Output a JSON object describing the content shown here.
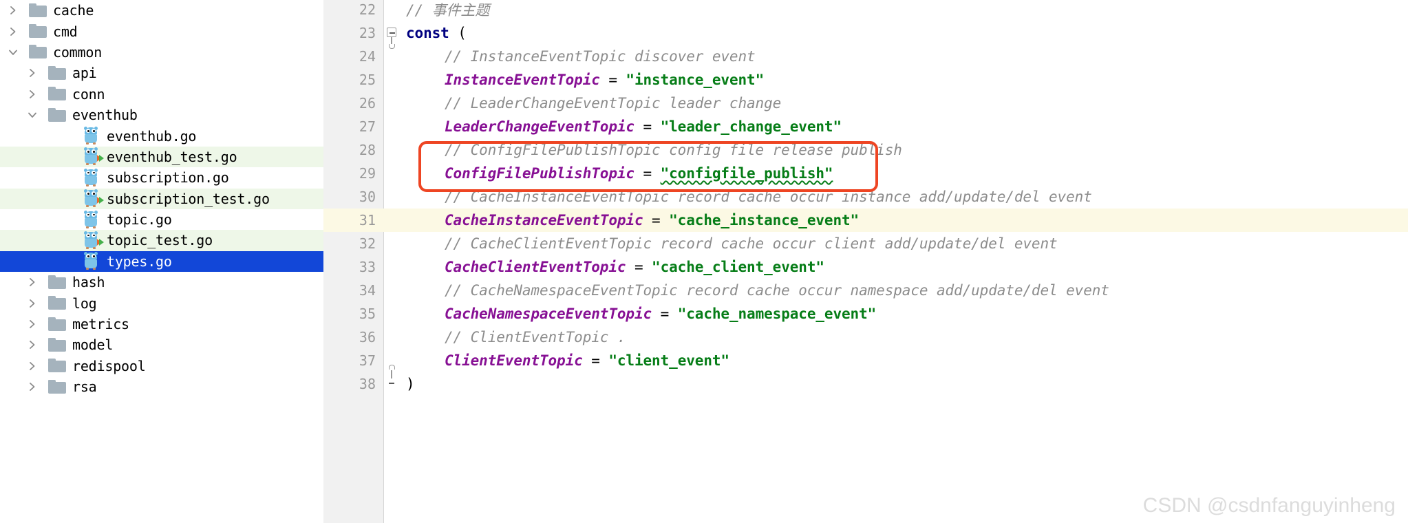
{
  "colors": {
    "selection_blue": "#1247d8",
    "modified_green": "#eef7e8",
    "caret_line_yellow": "#fcf9e4",
    "annotation_red": "#ee4523",
    "keyword_navy": "#000080",
    "identifier_purple": "#871094",
    "string_green": "#067d17",
    "comment_gray": "#8c8c8c",
    "gutter_gray": "#f1f1f1",
    "folder_gray": "#a5b3bd",
    "gopher_blue": "#69b9e4"
  },
  "sidebar": {
    "name": "project-file-tree",
    "items": [
      {
        "label": "cache",
        "type": "folder",
        "depth": 0,
        "expanded": false,
        "state": "normal",
        "icon": "folder-icon"
      },
      {
        "label": "cmd",
        "type": "folder",
        "depth": 0,
        "expanded": false,
        "state": "normal",
        "icon": "folder-icon"
      },
      {
        "label": "common",
        "type": "folder",
        "depth": 0,
        "expanded": true,
        "state": "normal",
        "icon": "folder-open-icon"
      },
      {
        "label": "api",
        "type": "folder",
        "depth": 1,
        "expanded": false,
        "state": "normal",
        "icon": "folder-icon"
      },
      {
        "label": "conn",
        "type": "folder",
        "depth": 1,
        "expanded": false,
        "state": "normal",
        "icon": "folder-icon"
      },
      {
        "label": "eventhub",
        "type": "folder",
        "depth": 1,
        "expanded": true,
        "state": "normal",
        "icon": "folder-open-icon"
      },
      {
        "label": "eventhub.go",
        "type": "gofile",
        "depth": 2,
        "expanded": null,
        "state": "normal",
        "icon": "go-file-icon"
      },
      {
        "label": "eventhub_test.go",
        "type": "gotest",
        "depth": 2,
        "expanded": null,
        "state": "modified",
        "icon": "go-test-file-icon"
      },
      {
        "label": "subscription.go",
        "type": "gofile",
        "depth": 2,
        "expanded": null,
        "state": "normal",
        "icon": "go-file-icon"
      },
      {
        "label": "subscription_test.go",
        "type": "gotest",
        "depth": 2,
        "expanded": null,
        "state": "modified",
        "icon": "go-test-file-icon"
      },
      {
        "label": "topic.go",
        "type": "gofile",
        "depth": 2,
        "expanded": null,
        "state": "normal",
        "icon": "go-file-icon"
      },
      {
        "label": "topic_test.go",
        "type": "gotest",
        "depth": 2,
        "expanded": null,
        "state": "modified",
        "icon": "go-test-file-icon"
      },
      {
        "label": "types.go",
        "type": "gofile",
        "depth": 2,
        "expanded": null,
        "state": "selected",
        "icon": "go-file-icon"
      },
      {
        "label": "hash",
        "type": "folder",
        "depth": 1,
        "expanded": false,
        "state": "normal",
        "icon": "folder-icon"
      },
      {
        "label": "log",
        "type": "folder",
        "depth": 1,
        "expanded": false,
        "state": "normal",
        "icon": "folder-icon"
      },
      {
        "label": "metrics",
        "type": "folder",
        "depth": 1,
        "expanded": false,
        "state": "normal",
        "icon": "folder-icon"
      },
      {
        "label": "model",
        "type": "folder",
        "depth": 1,
        "expanded": false,
        "state": "normal",
        "icon": "folder-icon"
      },
      {
        "label": "redispool",
        "type": "folder",
        "depth": 1,
        "expanded": false,
        "state": "normal",
        "icon": "folder-icon"
      },
      {
        "label": "rsa",
        "type": "folder",
        "depth": 1,
        "expanded": false,
        "state": "normal",
        "icon": "folder-icon"
      }
    ]
  },
  "editor": {
    "name": "code-editor",
    "language": "go",
    "first_line": 22,
    "caret_line": 31,
    "lines": [
      {
        "number": 22,
        "indent": 0,
        "fold": null,
        "tokens": [
          {
            "t": "comment",
            "v": "// 事件主题"
          }
        ]
      },
      {
        "number": 23,
        "indent": 0,
        "fold": "start",
        "tokens": [
          {
            "t": "kw",
            "v": "const"
          },
          {
            "t": "plain",
            "v": " "
          },
          {
            "t": "op",
            "v": "("
          }
        ]
      },
      {
        "number": 24,
        "indent": 1,
        "fold": null,
        "tokens": [
          {
            "t": "comment",
            "v": "// InstanceEventTopic discover event"
          }
        ]
      },
      {
        "number": 25,
        "indent": 1,
        "fold": null,
        "tokens": [
          {
            "t": "ident",
            "v": "InstanceEventTopic"
          },
          {
            "t": "plain",
            "v": " "
          },
          {
            "t": "op",
            "v": "="
          },
          {
            "t": "plain",
            "v": " "
          },
          {
            "t": "str",
            "v": "\"instance_event\""
          }
        ]
      },
      {
        "number": 26,
        "indent": 1,
        "fold": null,
        "tokens": [
          {
            "t": "comment",
            "v": "// LeaderChangeEventTopic leader change"
          }
        ]
      },
      {
        "number": 27,
        "indent": 1,
        "fold": null,
        "tokens": [
          {
            "t": "ident",
            "v": "LeaderChangeEventTopic"
          },
          {
            "t": "plain",
            "v": " "
          },
          {
            "t": "op",
            "v": "="
          },
          {
            "t": "plain",
            "v": " "
          },
          {
            "t": "str",
            "v": "\"leader_change_event\""
          }
        ]
      },
      {
        "number": 28,
        "indent": 1,
        "fold": null,
        "tokens": [
          {
            "t": "comment",
            "v": "// ConfigFilePublishTopic config file release publish"
          }
        ]
      },
      {
        "number": 29,
        "indent": 1,
        "fold": null,
        "tokens": [
          {
            "t": "ident",
            "v": "ConfigFilePublishTopic"
          },
          {
            "t": "plain",
            "v": " "
          },
          {
            "t": "op",
            "v": "="
          },
          {
            "t": "plain",
            "v": " "
          },
          {
            "t": "str-squiggle",
            "v": "\"configfile_publish\""
          }
        ]
      },
      {
        "number": 30,
        "indent": 1,
        "fold": null,
        "tokens": [
          {
            "t": "comment",
            "v": "// CacheInstanceEventTopic record cache occur instance add/update/del event"
          }
        ]
      },
      {
        "number": 31,
        "indent": 1,
        "fold": null,
        "tokens": [
          {
            "t": "ident",
            "v": "CacheInstanceEventTopic"
          },
          {
            "t": "plain",
            "v": " "
          },
          {
            "t": "op",
            "v": "="
          },
          {
            "t": "plain",
            "v": " "
          },
          {
            "t": "str",
            "v": "\"cache_instance_event\""
          }
        ]
      },
      {
        "number": 32,
        "indent": 1,
        "fold": null,
        "tokens": [
          {
            "t": "comment",
            "v": "// CacheClientEventTopic record cache occur client add/update/del event"
          }
        ]
      },
      {
        "number": 33,
        "indent": 1,
        "fold": null,
        "tokens": [
          {
            "t": "ident",
            "v": "CacheClientEventTopic"
          },
          {
            "t": "plain",
            "v": " "
          },
          {
            "t": "op",
            "v": "="
          },
          {
            "t": "plain",
            "v": " "
          },
          {
            "t": "str",
            "v": "\"cache_client_event\""
          }
        ]
      },
      {
        "number": 34,
        "indent": 1,
        "fold": null,
        "tokens": [
          {
            "t": "comment",
            "v": "// CacheNamespaceEventTopic record cache occur namespace add/update/del event"
          }
        ]
      },
      {
        "number": 35,
        "indent": 1,
        "fold": null,
        "tokens": [
          {
            "t": "ident",
            "v": "CacheNamespaceEventTopic"
          },
          {
            "t": "plain",
            "v": " "
          },
          {
            "t": "op",
            "v": "="
          },
          {
            "t": "plain",
            "v": " "
          },
          {
            "t": "str",
            "v": "\"cache_namespace_event\""
          }
        ]
      },
      {
        "number": 36,
        "indent": 1,
        "fold": null,
        "tokens": [
          {
            "t": "comment",
            "v": "// ClientEventTopic ."
          }
        ]
      },
      {
        "number": 37,
        "indent": 1,
        "fold": null,
        "tokens": [
          {
            "t": "ident",
            "v": "ClientEventTopic"
          },
          {
            "t": "plain",
            "v": " "
          },
          {
            "t": "op",
            "v": "="
          },
          {
            "t": "plain",
            "v": " "
          },
          {
            "t": "str",
            "v": "\"client_event\""
          }
        ]
      },
      {
        "number": 38,
        "indent": 0,
        "fold": "end",
        "tokens": [
          {
            "t": "op",
            "v": ")"
          }
        ]
      }
    ]
  },
  "annotation": {
    "name": "red-highlight-box",
    "covers_lines": [
      28,
      29
    ],
    "color": "#ee4523"
  },
  "watermark": {
    "text": "CSDN @csdnfanguyinheng"
  }
}
